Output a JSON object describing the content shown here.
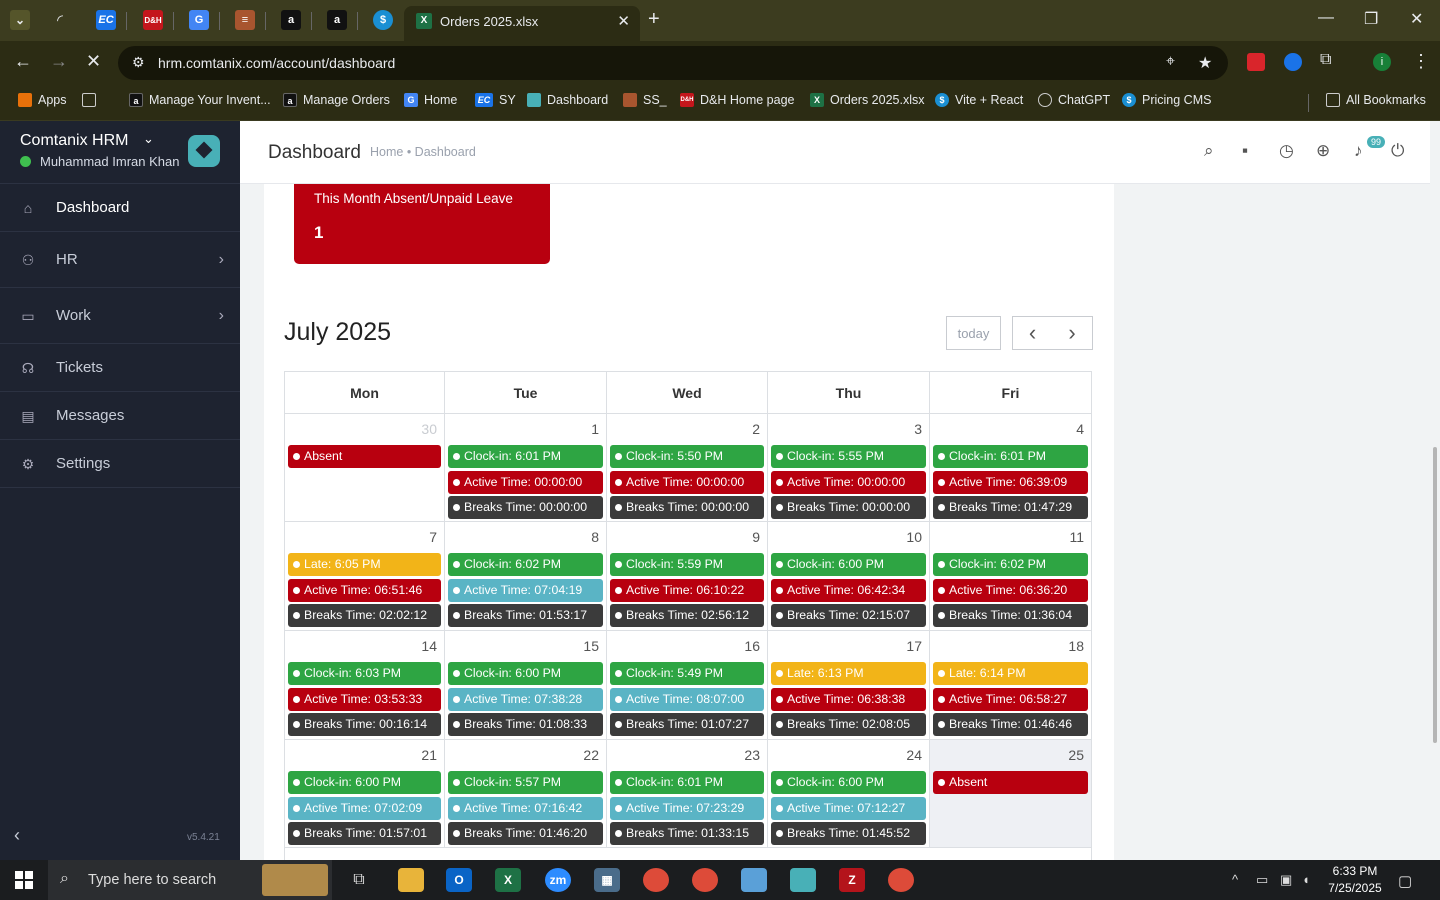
{
  "browser": {
    "active_tab_title": "Orders 2025.xlsx",
    "url": "hrm.comtanix.com/account/dashboard",
    "bookmarks": [
      {
        "label": "Apps"
      },
      {
        "label": ""
      },
      {
        "label": "Manage Your Invent..."
      },
      {
        "label": "Manage Orders"
      },
      {
        "label": "Home"
      },
      {
        "label": "SY"
      },
      {
        "label": "Dashboard"
      },
      {
        "label": "SS_"
      },
      {
        "label": "D&H Home page"
      },
      {
        "label": "Orders 2025.xlsx"
      },
      {
        "label": "Vite + React"
      },
      {
        "label": "ChatGPT"
      },
      {
        "label": "Pricing CMS"
      }
    ],
    "all_bookmarks": "All Bookmarks"
  },
  "sidebar": {
    "app_name": "Comtanix HRM",
    "user_name": "Muhammad Imran Khan",
    "items": [
      {
        "label": "Dashboard",
        "icon": "home-icon"
      },
      {
        "label": "HR",
        "icon": "users-icon"
      },
      {
        "label": "Work",
        "icon": "briefcase-icon"
      },
      {
        "label": "Tickets",
        "icon": "headset-icon"
      },
      {
        "label": "Messages",
        "icon": "message-icon"
      },
      {
        "label": "Settings",
        "icon": "gear-icon"
      }
    ],
    "version": "v5.4.21"
  },
  "header": {
    "title": "Dashboard",
    "breadcrumb": "Home • Dashboard",
    "notification_count": "99"
  },
  "absent_card": {
    "label": "This Month Absent/Unpaid Leave",
    "value": "1"
  },
  "calendar": {
    "title": "July 2025",
    "today_label": "today",
    "prev_label": "‹",
    "next_label": "›",
    "days": [
      "Mon",
      "Tue",
      "Wed",
      "Thu",
      "Fri"
    ],
    "weeks": [
      [
        {
          "day": "30",
          "other": true,
          "events": [
            {
              "text": "Absent",
              "color": "#b8000f"
            }
          ]
        },
        {
          "day": "1",
          "events": [
            {
              "text": "Clock-in: 6:01 PM",
              "color": "#2ea543"
            },
            {
              "text": "Active Time: 00:00:00",
              "color": "#b8000f"
            },
            {
              "text": "Breaks Time: 00:00:00",
              "color": "#3b3b3b"
            }
          ]
        },
        {
          "day": "2",
          "events": [
            {
              "text": "Clock-in: 5:50 PM",
              "color": "#2ea543"
            },
            {
              "text": "Active Time: 00:00:00",
              "color": "#b8000f"
            },
            {
              "text": "Breaks Time: 00:00:00",
              "color": "#3b3b3b"
            }
          ]
        },
        {
          "day": "3",
          "events": [
            {
              "text": "Clock-in: 5:55 PM",
              "color": "#2ea543"
            },
            {
              "text": "Active Time: 00:00:00",
              "color": "#b8000f"
            },
            {
              "text": "Breaks Time: 00:00:00",
              "color": "#3b3b3b"
            }
          ]
        },
        {
          "day": "4",
          "events": [
            {
              "text": "Clock-in: 6:01 PM",
              "color": "#2ea543"
            },
            {
              "text": "Active Time: 06:39:09",
              "color": "#b8000f"
            },
            {
              "text": "Breaks Time: 01:47:29",
              "color": "#3b3b3b"
            }
          ]
        }
      ],
      [
        {
          "day": "7",
          "events": [
            {
              "text": "Late: 6:05 PM",
              "color": "#f2b418"
            },
            {
              "text": "Active Time: 06:51:46",
              "color": "#b8000f"
            },
            {
              "text": "Breaks Time: 02:02:12",
              "color": "#3b3b3b"
            }
          ]
        },
        {
          "day": "8",
          "events": [
            {
              "text": "Clock-in: 6:02 PM",
              "color": "#2ea543"
            },
            {
              "text": "Active Time: 07:04:19",
              "color": "#5ab4c5"
            },
            {
              "text": "Breaks Time: 01:53:17",
              "color": "#3b3b3b"
            }
          ]
        },
        {
          "day": "9",
          "events": [
            {
              "text": "Clock-in: 5:59 PM",
              "color": "#2ea543"
            },
            {
              "text": "Active Time: 06:10:22",
              "color": "#b8000f"
            },
            {
              "text": "Breaks Time: 02:56:12",
              "color": "#3b3b3b"
            }
          ]
        },
        {
          "day": "10",
          "events": [
            {
              "text": "Clock-in: 6:00 PM",
              "color": "#2ea543"
            },
            {
              "text": "Active Time: 06:42:34",
              "color": "#b8000f"
            },
            {
              "text": "Breaks Time: 02:15:07",
              "color": "#3b3b3b"
            }
          ]
        },
        {
          "day": "11",
          "events": [
            {
              "text": "Clock-in: 6:02 PM",
              "color": "#2ea543"
            },
            {
              "text": "Active Time: 06:36:20",
              "color": "#b8000f"
            },
            {
              "text": "Breaks Time: 01:36:04",
              "color": "#3b3b3b"
            }
          ]
        }
      ],
      [
        {
          "day": "14",
          "events": [
            {
              "text": "Clock-in: 6:03 PM",
              "color": "#2ea543"
            },
            {
              "text": "Active Time: 03:53:33",
              "color": "#b8000f"
            },
            {
              "text": "Breaks Time: 00:16:14",
              "color": "#3b3b3b"
            }
          ]
        },
        {
          "day": "15",
          "events": [
            {
              "text": "Clock-in: 6:00 PM",
              "color": "#2ea543"
            },
            {
              "text": "Active Time: 07:38:28",
              "color": "#5ab4c5"
            },
            {
              "text": "Breaks Time: 01:08:33",
              "color": "#3b3b3b"
            }
          ]
        },
        {
          "day": "16",
          "events": [
            {
              "text": "Clock-in: 5:49 PM",
              "color": "#2ea543"
            },
            {
              "text": "Active Time: 08:07:00",
              "color": "#5ab4c5"
            },
            {
              "text": "Breaks Time: 01:07:27",
              "color": "#3b3b3b"
            }
          ]
        },
        {
          "day": "17",
          "events": [
            {
              "text": "Late: 6:13 PM",
              "color": "#f2b418"
            },
            {
              "text": "Active Time: 06:38:38",
              "color": "#b8000f"
            },
            {
              "text": "Breaks Time: 02:08:05",
              "color": "#3b3b3b"
            }
          ]
        },
        {
          "day": "18",
          "events": [
            {
              "text": "Late: 6:14 PM",
              "color": "#f2b418"
            },
            {
              "text": "Active Time: 06:58:27",
              "color": "#b8000f"
            },
            {
              "text": "Breaks Time: 01:46:46",
              "color": "#3b3b3b"
            }
          ]
        }
      ],
      [
        {
          "day": "21",
          "events": [
            {
              "text": "Clock-in: 6:00 PM",
              "color": "#2ea543"
            },
            {
              "text": "Active Time: 07:02:09",
              "color": "#5ab4c5"
            },
            {
              "text": "Breaks Time: 01:57:01",
              "color": "#3b3b3b"
            }
          ]
        },
        {
          "day": "22",
          "events": [
            {
              "text": "Clock-in: 5:57 PM",
              "color": "#2ea543"
            },
            {
              "text": "Active Time: 07:16:42",
              "color": "#5ab4c5"
            },
            {
              "text": "Breaks Time: 01:46:20",
              "color": "#3b3b3b"
            }
          ]
        },
        {
          "day": "23",
          "events": [
            {
              "text": "Clock-in: 6:01 PM",
              "color": "#2ea543"
            },
            {
              "text": "Active Time: 07:23:29",
              "color": "#5ab4c5"
            },
            {
              "text": "Breaks Time: 01:33:15",
              "color": "#3b3b3b"
            }
          ]
        },
        {
          "day": "24",
          "events": [
            {
              "text": "Clock-in: 6:00 PM",
              "color": "#2ea543"
            },
            {
              "text": "Active Time: 07:12:27",
              "color": "#5ab4c5"
            },
            {
              "text": "Breaks Time: 01:45:52",
              "color": "#3b3b3b"
            }
          ]
        },
        {
          "day": "25",
          "today": true,
          "events": [
            {
              "text": "Absent",
              "color": "#b8000f"
            }
          ]
        }
      ]
    ]
  },
  "taskbar": {
    "search_placeholder": "Type here to search",
    "time": "6:33 PM",
    "date": "7/25/2025"
  }
}
